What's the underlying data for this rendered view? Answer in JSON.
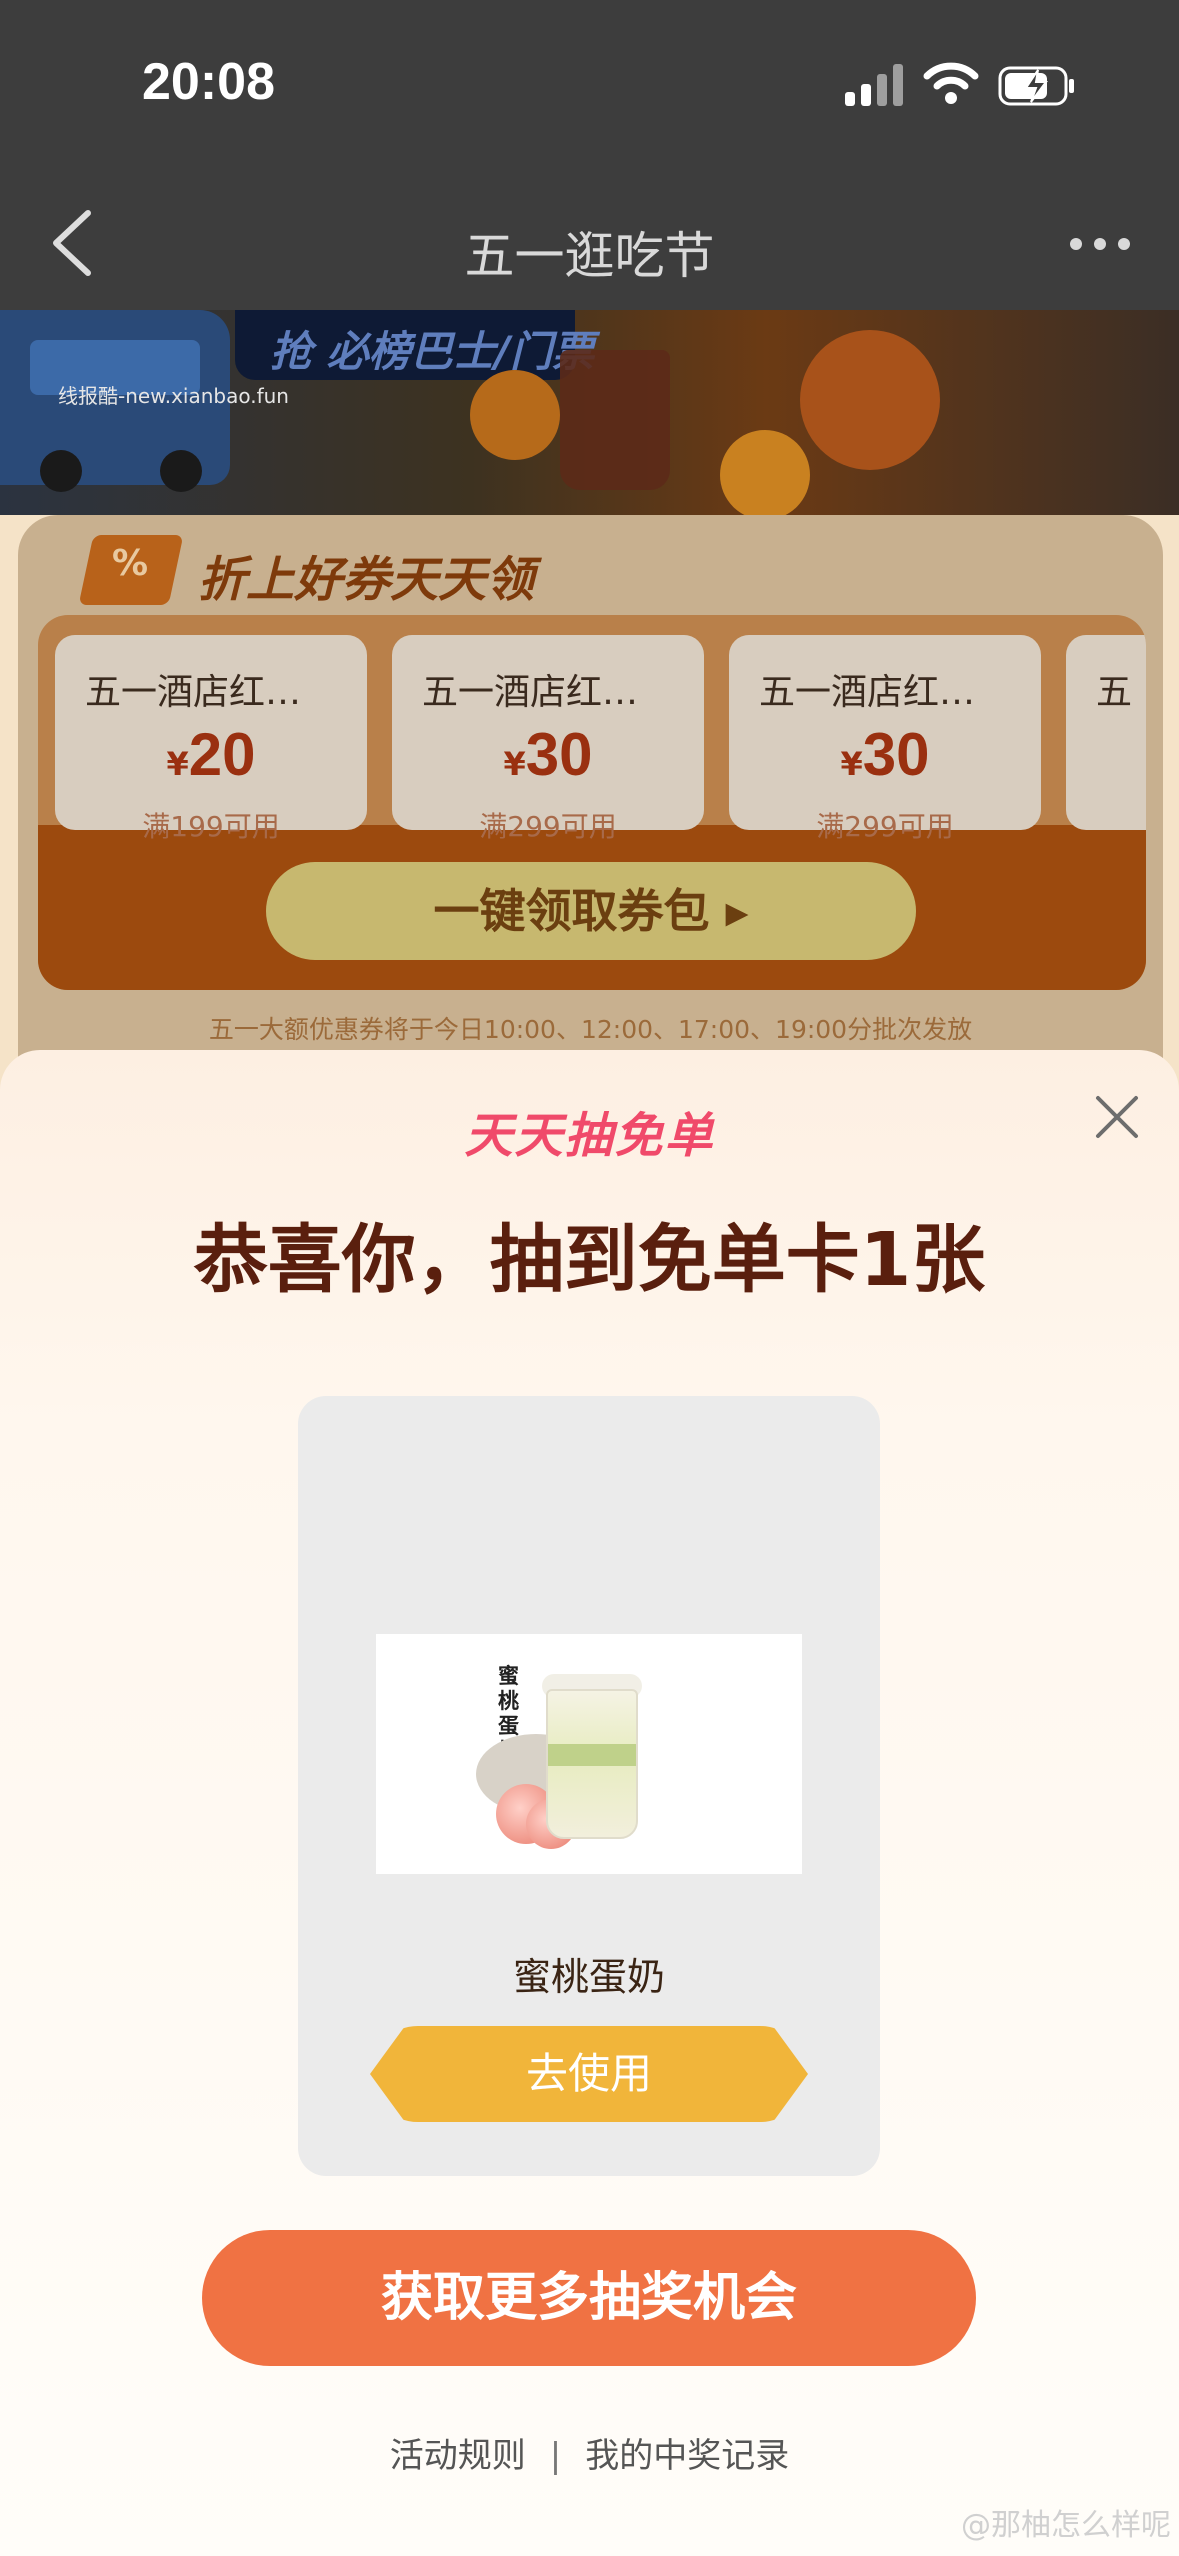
{
  "status_bar": {
    "time": "20:08"
  },
  "nav": {
    "title": "五一逛吃节"
  },
  "banner": {
    "tag_text": "抢 必榜巴士/门票",
    "watermark": "线报酷-new.xianbao.fun"
  },
  "coupon_panel": {
    "heading": "折上好券天天领",
    "percent_symbol": "%",
    "coupons": [
      {
        "name": "五一酒店红…",
        "currency": "¥",
        "amount": "20",
        "condition": "满199可用"
      },
      {
        "name": "五一酒店红…",
        "currency": "¥",
        "amount": "30",
        "condition": "满299可用"
      },
      {
        "name": "五一酒店红…",
        "currency": "¥",
        "amount": "30",
        "condition": "满299可用"
      },
      {
        "name": "五"
      }
    ],
    "claim_button": "一键领取券包 ▸",
    "notice": "五一大额优惠券将于今日10:00、12:00、17:00、19:00分批次发放"
  },
  "sheet": {
    "logo": "天天抽免单",
    "title": "恭喜你，抽到免单卡1张",
    "prize": {
      "image_label": "蜜桃蛋奶",
      "name": "蜜桃蛋奶",
      "use_button": "去使用"
    },
    "more_button": "获取更多抽奖机会",
    "rules_link": "活动规则",
    "separator": "|",
    "records_link": "我的中奖记录"
  },
  "footer_watermark": "@那柚怎么样呢",
  "colors": {
    "primary_orange": "#f07243",
    "use_yellow": "#f1b53a",
    "title_brown": "#5a1f0e",
    "logo_pink": "#f04a6a"
  }
}
